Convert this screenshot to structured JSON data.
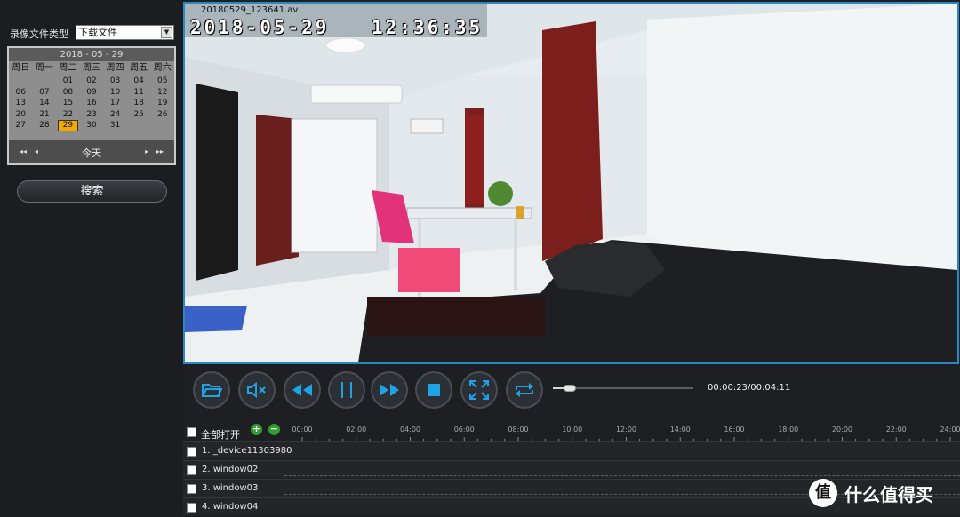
{
  "left_panel": {
    "type_label": "录像文件类型",
    "type_select_value": "下载文件",
    "calendar": {
      "title": "2018 - 05 - 29",
      "weekdays": [
        "周日",
        "周一",
        "周二",
        "周三",
        "周四",
        "周五",
        "周六"
      ],
      "days": [
        "",
        "",
        "01",
        "02",
        "03",
        "04",
        "05",
        "06",
        "07",
        "08",
        "09",
        "10",
        "11",
        "12",
        "13",
        "14",
        "15",
        "16",
        "17",
        "18",
        "19",
        "20",
        "21",
        "22",
        "23",
        "24",
        "25",
        "26",
        "27",
        "28",
        "29",
        "30",
        "31",
        "",
        ""
      ],
      "selected_day": "29",
      "today_label": "今天",
      "nav_prev_year": "◂◂",
      "nav_prev_month": "◂",
      "nav_next_month": "▸",
      "nav_next_year": "▸▸"
    },
    "search_label": "搜索"
  },
  "video": {
    "file_name": "20180529_123641.av",
    "timestamp_date": "2018-05-29",
    "timestamp_time": "12:36:35"
  },
  "controls": {
    "icons": [
      "open-folder-icon",
      "mute-icon",
      "rewind-icon",
      "pause-icon",
      "fast-forward-icon",
      "stop-icon",
      "fullscreen-icon",
      "loop-icon"
    ],
    "progress_fraction": 0.09,
    "time_display": "00:00:23/00:04:11"
  },
  "timeline": {
    "open_all_label": "全部打开",
    "ticks": [
      "00:00",
      "02:00",
      "04:00",
      "06:00",
      "08:00",
      "10:00",
      "12:00",
      "14:00",
      "16:00",
      "18:00",
      "20:00",
      "22:00",
      "24:00"
    ],
    "channels": [
      "1. _device11303980",
      "2. window02",
      "3. window03",
      "4. window04"
    ]
  },
  "watermark": {
    "icon_text": "值",
    "text": "什么值得买"
  },
  "colors": {
    "accent": "#2a88c5",
    "icon_blue": "#1ea4e6",
    "selected_day": "#f3a900"
  }
}
